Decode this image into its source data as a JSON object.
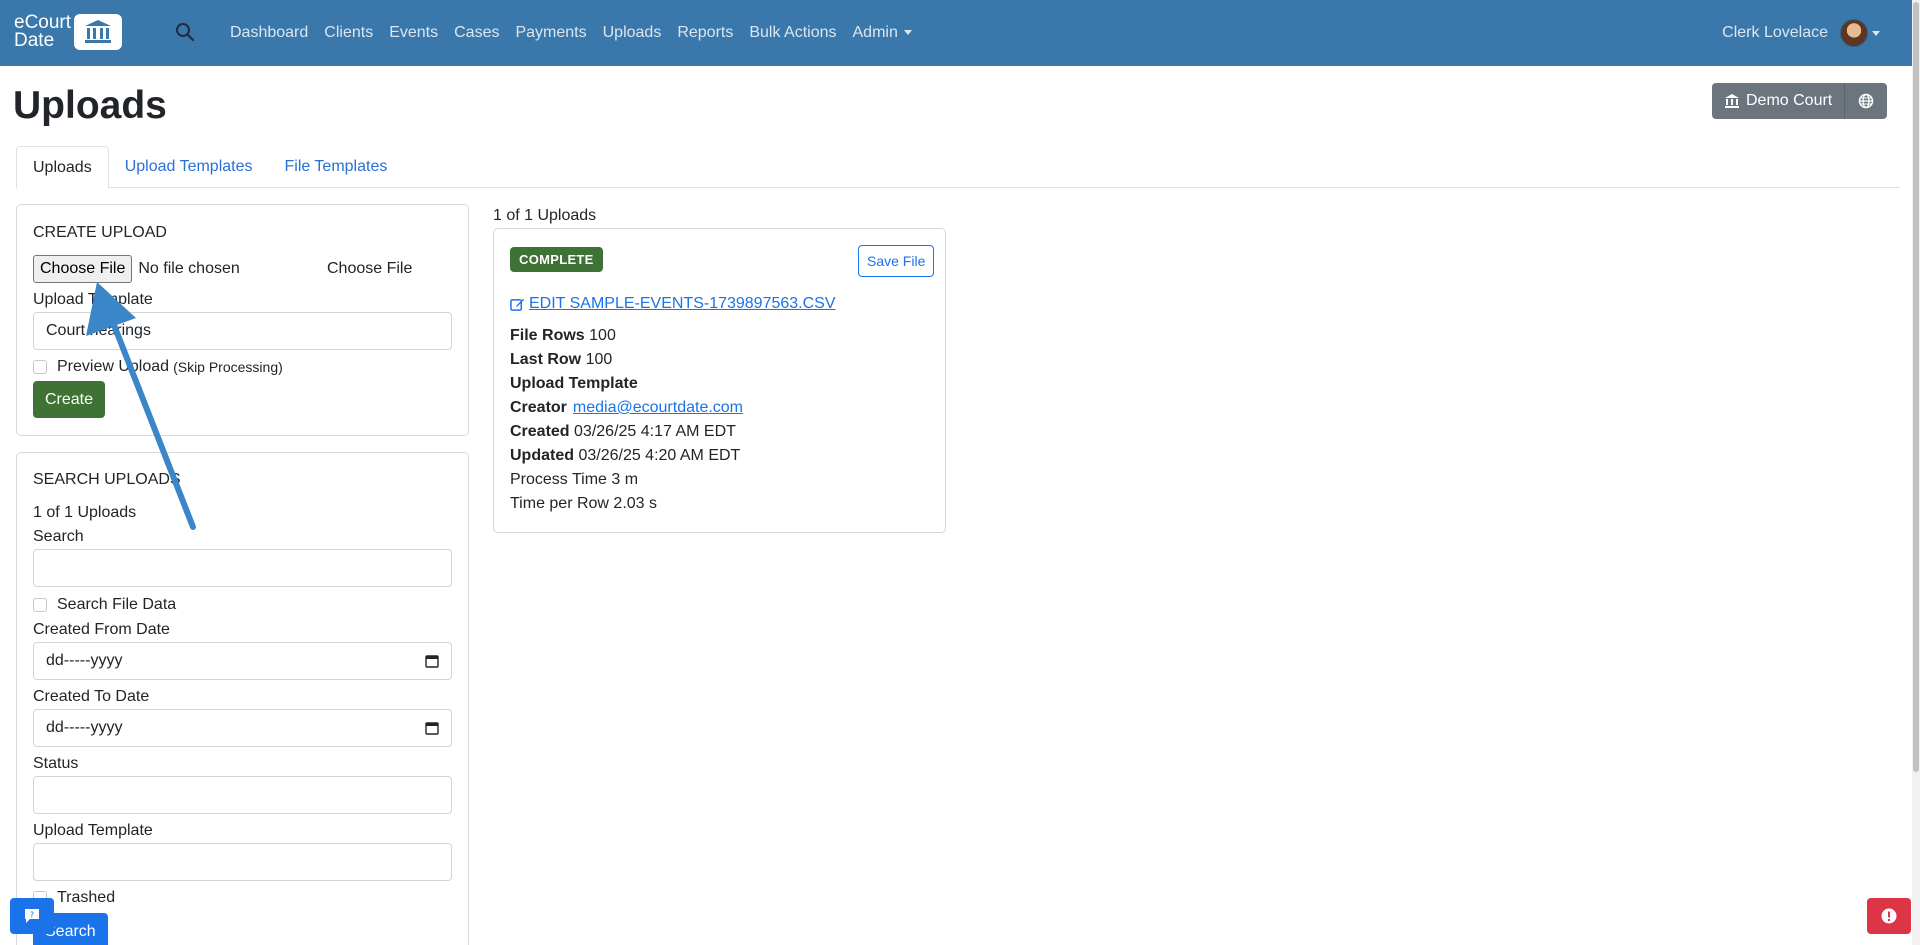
{
  "brand": {
    "line1": "eCourt",
    "line2": "Date"
  },
  "nav": {
    "items": [
      "Dashboard",
      "Clients",
      "Events",
      "Cases",
      "Payments",
      "Uploads",
      "Reports",
      "Bulk Actions",
      "Admin"
    ],
    "user_name": "Clerk Lovelace"
  },
  "page": {
    "title": "Uploads",
    "court_button": "Demo Court"
  },
  "tabs": [
    "Uploads",
    "Upload Templates",
    "File Templates"
  ],
  "create_upload": {
    "heading": "CREATE UPLOAD",
    "choose_file_button": "Choose File",
    "no_file_text": "No file chosen",
    "choose_file_label": "Choose File",
    "template_label": "Upload Template",
    "template_value": "Court hearings",
    "preview_label": "Preview Upload",
    "preview_hint": "(Skip Processing)",
    "create_button": "Create"
  },
  "search_uploads": {
    "heading": "SEARCH UPLOADS",
    "count": "1 of 1 Uploads",
    "search_label": "Search",
    "search_value": "",
    "search_file_data_label": "Search File Data",
    "created_from_label": "Created From Date",
    "created_from_placeholder": "dd-----yyyy",
    "created_to_label": "Created To Date",
    "created_to_placeholder": "dd-----yyyy",
    "status_label": "Status",
    "status_value": "",
    "upload_template_label": "Upload Template",
    "upload_template_value": "",
    "trashed_label": "Trashed",
    "search_button": "Search"
  },
  "results": {
    "count": "1 of 1 Uploads",
    "card": {
      "status": "COMPLETE",
      "save_button": "Save File",
      "edit_link": "EDIT SAMPLE-EVENTS-1739897563.CSV",
      "file_rows_label": "File Rows",
      "file_rows": "100",
      "last_row_label": "Last Row",
      "last_row": "100",
      "template_label": "Upload Template",
      "creator_label": "Creator",
      "creator": "media@ecourtdate.com",
      "created_label": "Created",
      "created": "03/26/25 4:17 AM EDT",
      "updated_label": "Updated",
      "updated": "03/26/25 4:20 AM EDT",
      "process_time": "Process Time 3 m",
      "time_per_row": "Time per Row 2.03 s"
    }
  },
  "colors": {
    "navbar": "#3a77ab",
    "success": "#3f7336",
    "primary": "#1a73e8",
    "secondary": "#6c757d",
    "danger": "#dc3545",
    "annotation_arrow": "#3a86c8"
  },
  "icons": {
    "search": "search-icon",
    "court": "bank-icon",
    "globe": "globe-icon",
    "edit": "edit-icon",
    "calendar": "calendar-icon",
    "chat": "chat-icon",
    "alert": "alert-icon"
  }
}
